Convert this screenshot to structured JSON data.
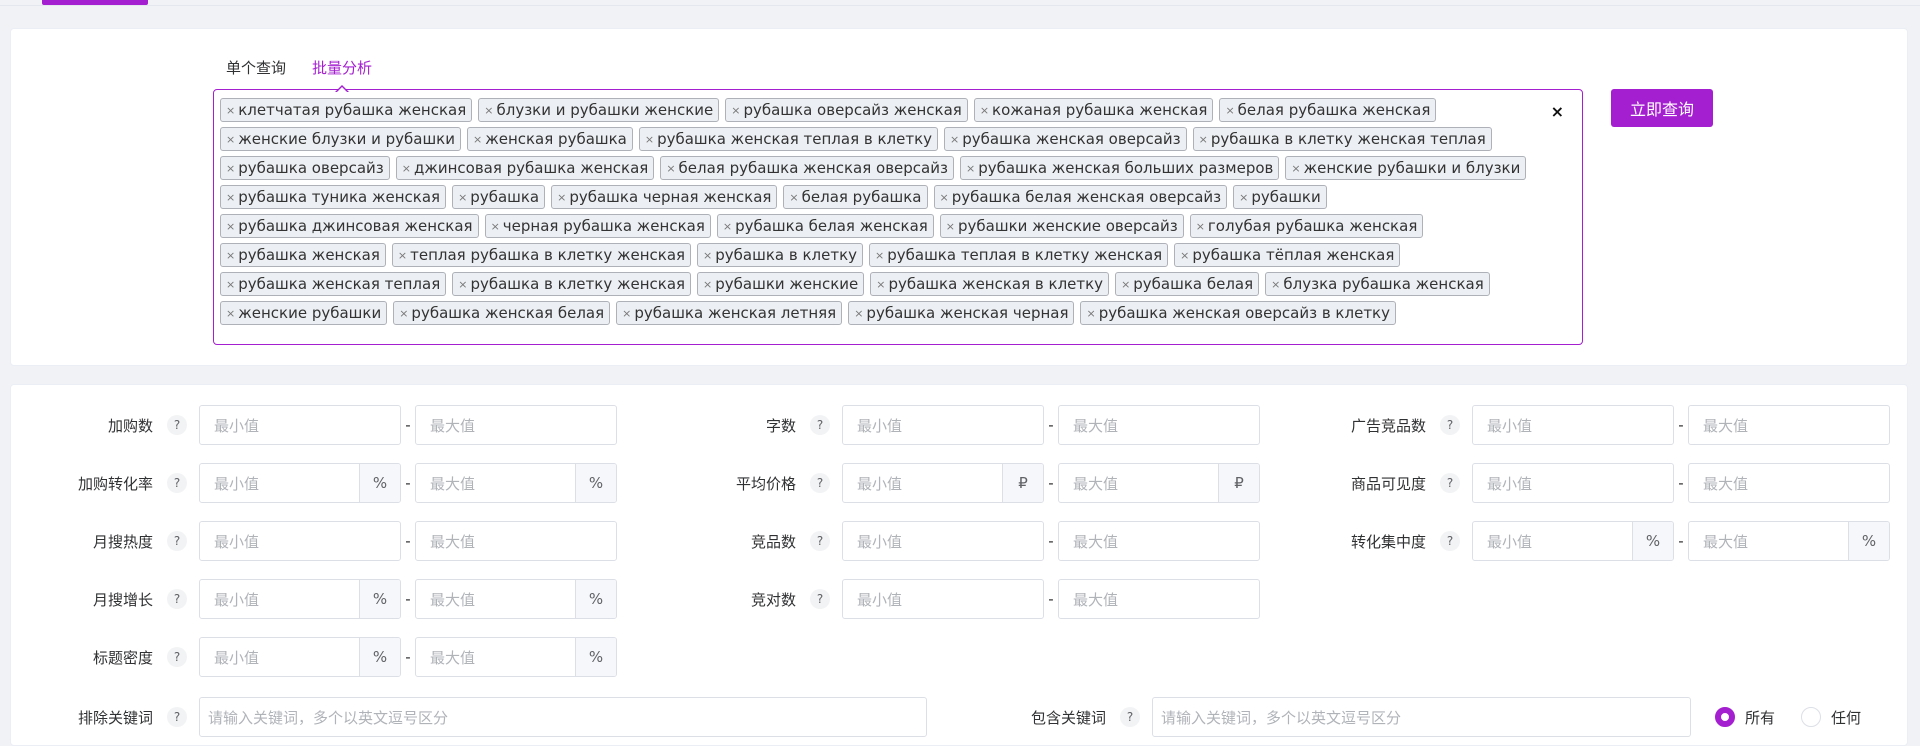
{
  "tabs": [
    {
      "label": "单个查询",
      "active": false
    },
    {
      "label": "批量分析",
      "active": true
    }
  ],
  "accent_color": "#a41fd0",
  "keywords": [
    "клетчатая рубашка женская",
    "блузки и рубашки женские",
    "рубашка оверсайз женская",
    "кожаная рубашка женская",
    "белая рубашка женская",
    "женские блузки и рубашки",
    "женская рубашка",
    "рубашка женская теплая в клетку",
    "рубашка женская оверсайз",
    "рубашка в клетку женская теплая",
    "рубашка оверсайз",
    "джинсовая рубашка женская",
    "белая рубашка женская оверсайз",
    "рубашка женская больших размеров",
    "женские рубашки и блузки",
    "рубашка туника женская",
    "рубашка",
    "рубашка черная женская",
    "белая рубашка",
    "рубашка белая женская оверсайз",
    "рубашки",
    "рубашка джинсовая женская",
    "черная рубашка женская",
    "рубашка белая женская",
    "рубашки женские оверсайз",
    "голубая рубашка женская",
    "рубашка женская",
    "теплая рубашка в клетку женская",
    "рубашка в клетку",
    "рубашка теплая в клетку женская",
    "рубашка тёплая женская",
    "рубашка женская теплая",
    "рубашка в клетку женская",
    "рубашки женские",
    "рубашка женская в клетку",
    "рубашка белая",
    "блузка рубашка женская",
    "женские рубашки",
    "рубашка женская белая",
    "рубашка женская летняя",
    "рубашка женская черная",
    "рубашка женская оверсайз в клетку"
  ],
  "tag_remove_glyph": "×",
  "clear_glyph": "×",
  "query_button": "立即查询",
  "help_glyph": "?",
  "dash": "-",
  "min_ph": "最小值",
  "max_ph": "最大值",
  "filters": {
    "col1": [
      {
        "label": "加购数",
        "suffix": ""
      },
      {
        "label": "加购转化率",
        "suffix": "%"
      },
      {
        "label": "月搜热度",
        "suffix": ""
      },
      {
        "label": "月搜增长",
        "suffix": "%"
      },
      {
        "label": "标题密度",
        "suffix": "%"
      }
    ],
    "col2": [
      {
        "label": "字数",
        "suffix": ""
      },
      {
        "label": "平均价格",
        "suffix": "₽"
      },
      {
        "label": "竞品数",
        "suffix": ""
      },
      {
        "label": "竞对数",
        "suffix": ""
      }
    ],
    "col3": [
      {
        "label": "广告竞品数",
        "suffix": ""
      },
      {
        "label": "商品可见度",
        "suffix": ""
      },
      {
        "label": "转化集中度",
        "suffix": "%"
      }
    ]
  },
  "exclude": {
    "label": "排除关键词",
    "placeholder": "请输入关键词，多个以英文逗号区分"
  },
  "include": {
    "label": "包含关键词",
    "placeholder": "请输入关键词，多个以英文逗号区分"
  },
  "match_options": [
    {
      "label": "所有",
      "checked": true
    },
    {
      "label": "任何",
      "checked": false
    }
  ]
}
